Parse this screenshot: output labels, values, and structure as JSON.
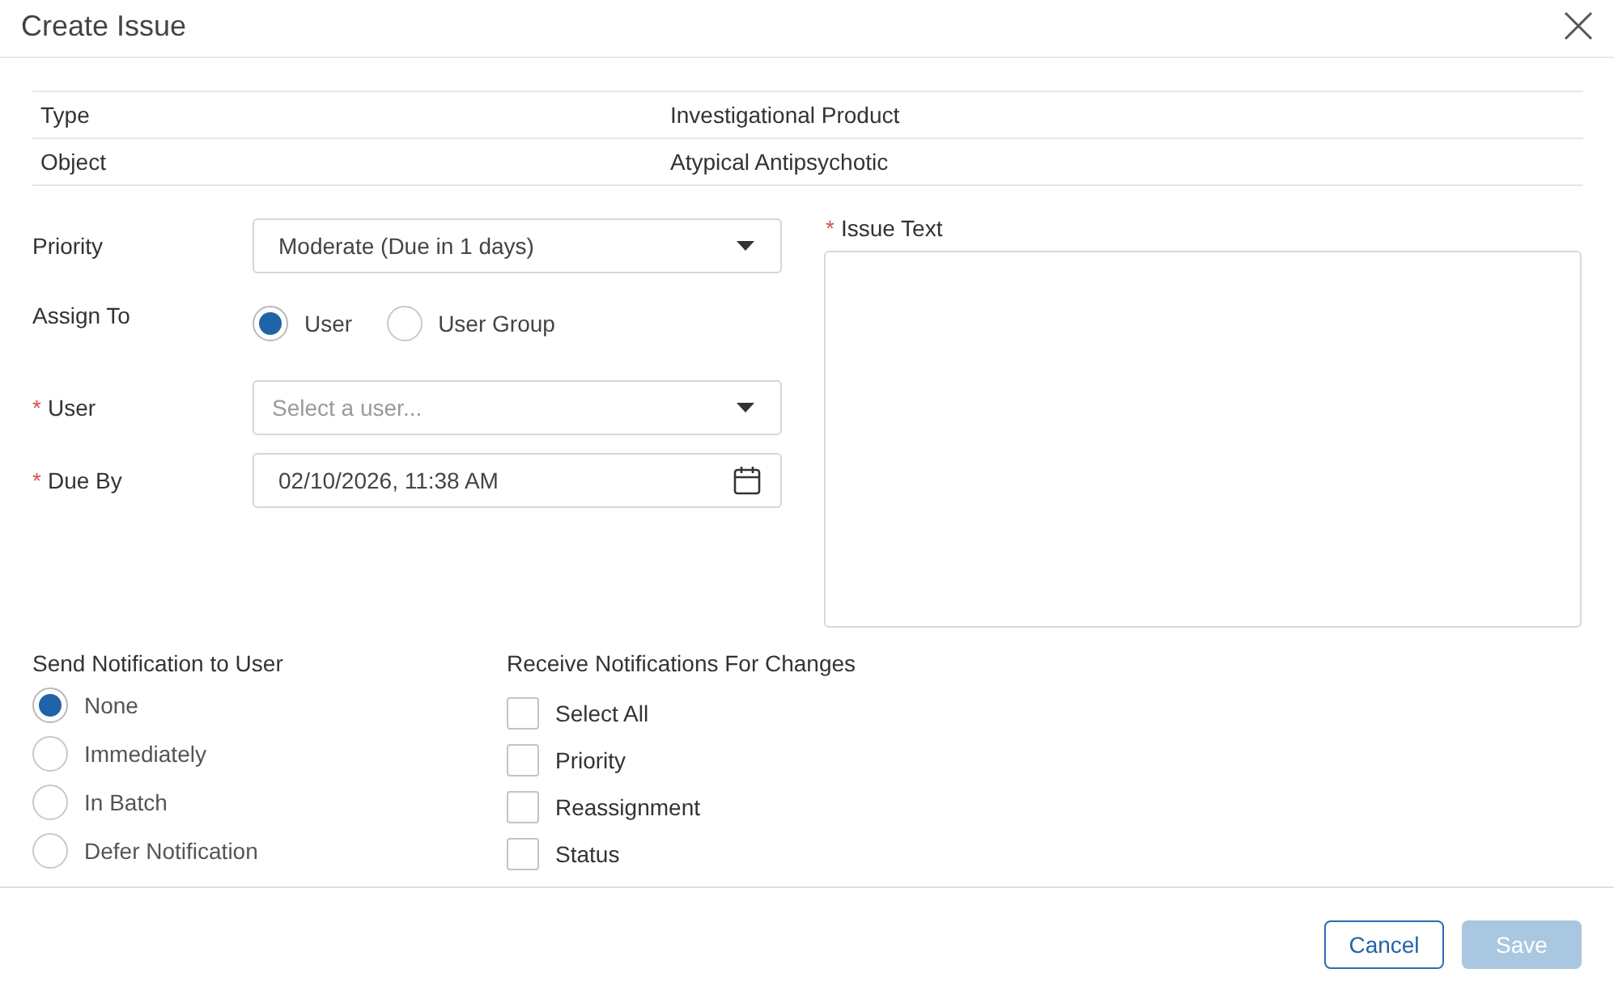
{
  "dialog": {
    "title": "Create Issue"
  },
  "summary": {
    "rows": [
      {
        "label": "Type",
        "value": "Investigational Product"
      },
      {
        "label": "Object",
        "value": "Atypical Antipsychotic"
      }
    ]
  },
  "fields": [
    {
      "kind": "select",
      "label": "Priority",
      "value": "Moderate (Due in 1 days)"
    },
    {
      "kind": "radio_group",
      "label": "Assign To",
      "options": [
        {
          "label": "User",
          "selected": true
        },
        {
          "label": "User Group",
          "selected": false
        }
      ]
    },
    {
      "kind": "select",
      "label": "User",
      "required_mark": "*",
      "placeholder": "Select a user..."
    },
    {
      "kind": "date",
      "label": "Due By",
      "required_mark": "*",
      "value": "02/10/2026, 11:38 AM"
    }
  ],
  "issue_text": {
    "label": "Issue Text",
    "required_mark": "*"
  },
  "notify_user": {
    "title": "Send Notification to User",
    "options": [
      {
        "label": "None",
        "selected": true
      },
      {
        "label": "Immediately",
        "selected": false
      },
      {
        "label": "In Batch",
        "selected": false
      },
      {
        "label": "Defer Notification",
        "selected": false
      }
    ]
  },
  "notify_changes": {
    "title": "Receive Notifications For Changes",
    "options": [
      {
        "label": "Select All",
        "checked": false
      },
      {
        "label": "Priority",
        "checked": false
      },
      {
        "label": "Reassignment",
        "checked": false
      },
      {
        "label": "Status",
        "checked": false
      }
    ]
  },
  "buttons": [
    {
      "kind": "secondary",
      "label": "Cancel",
      "disabled": false
    },
    {
      "kind": "primary",
      "label": "Save",
      "disabled": true
    }
  ]
}
